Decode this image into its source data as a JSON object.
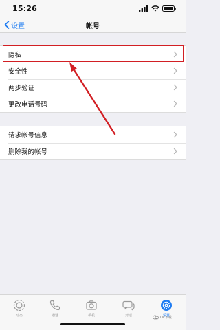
{
  "status_bar": {
    "time": "15:26"
  },
  "nav": {
    "back_label": "设置",
    "title": "帐号"
  },
  "group1": [
    {
      "label": "隐私"
    },
    {
      "label": "安全性"
    },
    {
      "label": "两步验证"
    },
    {
      "label": "更改电话号码"
    }
  ],
  "group2": [
    {
      "label": "请求帐号信息"
    },
    {
      "label": "删除我的帐号"
    }
  ],
  "tabs": [
    {
      "label": "动态",
      "icon": "status-icon",
      "active": false
    },
    {
      "label": "通话",
      "icon": "phone-icon",
      "active": false
    },
    {
      "label": "相机",
      "icon": "camera-icon",
      "active": false
    },
    {
      "label": "对话",
      "icon": "chat-icon",
      "active": false
    },
    {
      "label": "设置",
      "icon": "gear-icon",
      "active": true
    }
  ],
  "watermark": {
    "text": "Ok下载"
  },
  "colors": {
    "accent": "#1e7cf2",
    "highlight": "#d21f24",
    "background": "#efeff4"
  }
}
